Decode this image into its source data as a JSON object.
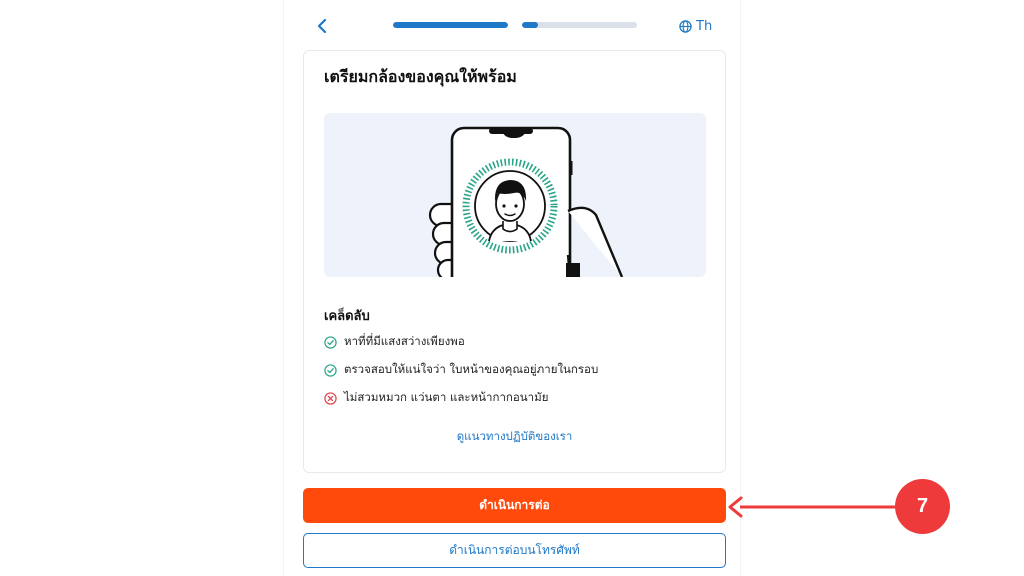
{
  "header": {
    "back_icon": "chevron-left-icon",
    "progress": [
      {
        "fraction": 1.0
      },
      {
        "fraction": 0.14
      }
    ],
    "language": {
      "icon": "globe-icon",
      "label": "Th"
    }
  },
  "card": {
    "title": "เตรียมกล้องของคุณให้พร้อม",
    "illustration": "phone-face-scan-illustration",
    "tips_title": "เคล็ดลับ",
    "tips": [
      {
        "text": "หาที่ที่มีแสงสว่างเพียงพอ",
        "icon": "check-circle-icon",
        "status": "do"
      },
      {
        "text": "ตรวจสอบให้แน่ใจว่า ใบหน้าของคุณอยู่ภายในกรอบ",
        "icon": "check-circle-icon",
        "status": "do"
      },
      {
        "text": "ไม่สวมหมวก แว่นตา และหน้ากากอนามัย",
        "icon": "x-circle-icon",
        "status": "dont"
      }
    ],
    "guidelines_link": "ดูแนวทางปฏิบัติของเรา"
  },
  "actions": {
    "continue_label": "ดำเนินการต่อ",
    "continue_on_phone_label": "ดำเนินการต่อบนโทรศัพท์"
  },
  "annotation": {
    "step": "7"
  },
  "colors": {
    "accent": "#1f78c8",
    "primary_button": "#ff4a0b",
    "success": "#2aa58a",
    "error": "#e0424a",
    "annotation": "#ee3a3a"
  }
}
